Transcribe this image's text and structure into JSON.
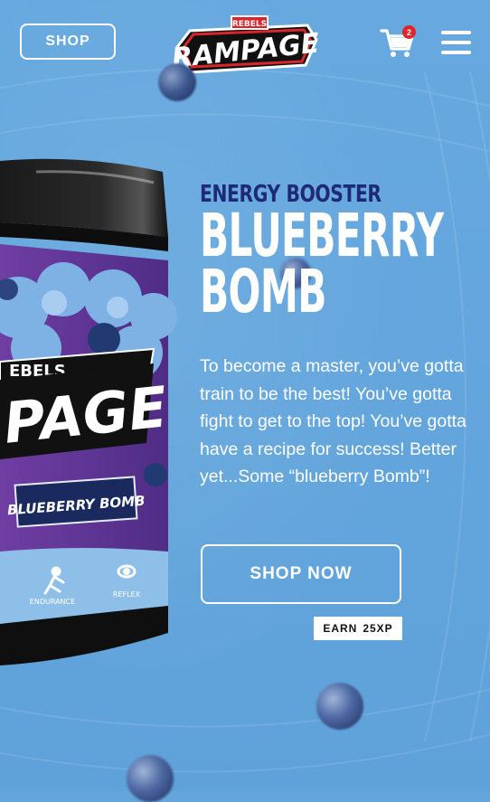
{
  "header": {
    "shop_label": "SHOP",
    "logo_brand": "RAMPAGE",
    "logo_sub": "REBELS",
    "cart_count": "2",
    "cart_icon": "cart-icon",
    "menu_icon": "hamburger-menu-icon"
  },
  "hero": {
    "kicker": "ENERGY BOOSTER",
    "title_line1": "BLUEBERRY",
    "title_line2": "BOMB",
    "description": "To become a master, you’ve gotta train to be the best! You’ve gotta fight to get to the top! You’ve gotta have a recipe for success! Better yet...Some “blueberry Bomb”!",
    "cta_label": "SHOP NOW",
    "xp_label": "EARN",
    "xp_value": "25XP"
  },
  "product": {
    "brand_fragment": "PAGE",
    "brand_sub_fragment": "EBELS",
    "flavor_label": "BLUEBERRY BOMB",
    "icon_left_label": "ENDURANCE",
    "icon_right_label": "REFLEX"
  },
  "colors": {
    "background": "#64a6dc",
    "kicker": "#1e2a78",
    "badge": "#e0262d"
  }
}
